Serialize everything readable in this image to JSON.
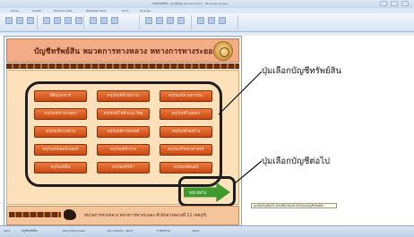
{
  "window": {
    "title": "บัญชีทรัพย์สิน : ฐานข้อมูล (Access 2007) - Microsoft Access",
    "menu": [
      "Home",
      "Create",
      "External Data",
      "Database Tools",
      "Form",
      "Arrange"
    ]
  },
  "form": {
    "banner_title": "บัญชีทรัพย์สิน  หมวดการทางหลวง  หทางการทางระยอง",
    "buttons": [
      "ที่ดิน/อาคาร",
      "ครุภัณฑ์สำนักงาน",
      "ครุภัณฑ์ยานพาหนะ",
      "ครุภัณฑ์การเกษตร",
      "ครุภัณฑ์ไฟฟ้าและวิทยุ",
      "ครุภัณฑ์โฆษณา",
      "ครุภัณฑ์งานบ้าน",
      "ครุภัณฑ์การแพทย์",
      "ครุภัณฑ์ก่อสร้าง",
      "ครุภัณฑ์คอมพิวเตอร์",
      "ครุภัณฑ์สำรวจ",
      "ครุภัณฑ์วิทยาศาสตร์",
      "ครุภัณฑ์อื่น",
      "ครุภัณฑ์กีฬา",
      "ครุภัณฑ์ดนตรี"
    ],
    "next_label": "หน้าถัดไป",
    "footer_text": "หมวดการทางหลวง หทางการทางระยอง สำนักทางหลวงที่ 12 (ชลบุรี)",
    "tooltip": "ปุ่มเลือกบัญชีต่อไป คลิกเพื่อไปยังหน้าถัดไปของบัญชีทรัพย์สิน"
  },
  "callouts": {
    "buttons_group": "ปุ่มเลือกบัญชีทรัพย์สิน",
    "next_button": "ปุ่มเลือกบัญชีต่อไป"
  },
  "taskbar": [
    "start",
    "บัญชีทรัพย์สิน",
    "Microsoft Access",
    "Document1 - Word",
    "ภาพหน้าจอ",
    "Paint"
  ],
  "colors": {
    "banner": "#f3ad86",
    "panel": "#fde1bb",
    "button": "#d85a1e",
    "next_arrow": "#3e9a2c"
  }
}
